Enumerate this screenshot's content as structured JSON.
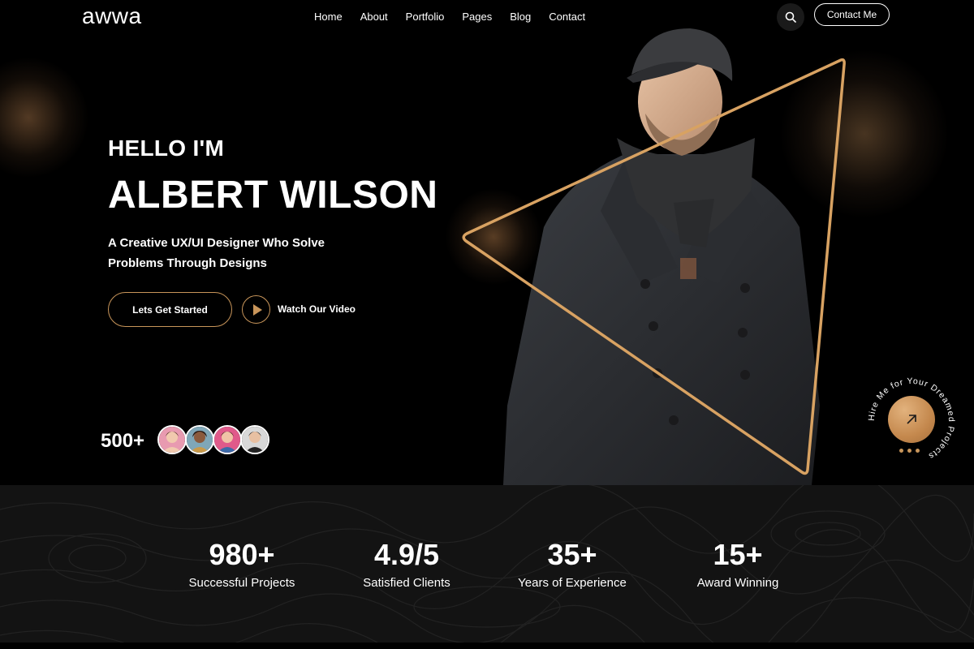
{
  "brand": {
    "logo": "awwa",
    "accent": "#c8955a"
  },
  "nav": {
    "items": [
      "Home",
      "About",
      "Portfolio",
      "Pages",
      "Blog",
      "Contact"
    ],
    "contact_button": "Contact Me",
    "search_icon": "search-icon"
  },
  "hero": {
    "greeting": "HELLO I'M",
    "name": "ALBERT WILSON",
    "subtitle_line1": "A Creative UX/UI Designer Who Solve",
    "subtitle_line2": "Problems Through Designs",
    "cta_label": "Lets Get Started",
    "video_label": "Watch Our Video",
    "client_count": "500+",
    "hire_text": "Hire Me for Your Dreamed Projects"
  },
  "stats": [
    {
      "value": "980+",
      "label": "Successful Projects"
    },
    {
      "value": "4.9/5",
      "label": "Satisfied Clients"
    },
    {
      "value": "35+",
      "label": "Years of Experience"
    },
    {
      "value": "15+",
      "label": "Award Winning"
    }
  ]
}
